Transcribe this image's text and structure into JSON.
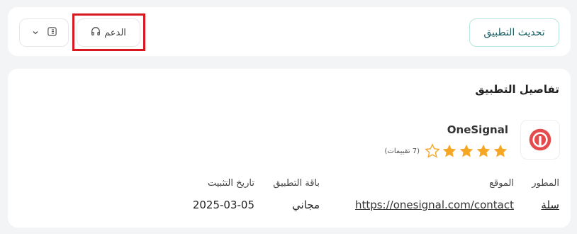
{
  "header": {
    "update_label": "تحديث التطبيق",
    "support_label": "الدعم"
  },
  "details": {
    "title": "تفاصيل التطبيق",
    "app_name": "OneSignal",
    "rating": 4,
    "rating_max": 5,
    "rating_count": "(7 تقييمات)",
    "fields": {
      "developer_label": "المطور",
      "developer_value": "سلة",
      "website_label": "الموقع",
      "website_value": "https://onesignal.com/contact",
      "plan_label": "باقة التطبيق",
      "plan_value": "مجاني",
      "install_date_label": "تاريخ التثبيت",
      "install_date_value": "2025-03-05"
    }
  },
  "colors": {
    "accent_teal": "#1d5f63",
    "star_filled": "#f5a623",
    "highlight": "#d7191f",
    "logo_red": "#e54b4d"
  }
}
